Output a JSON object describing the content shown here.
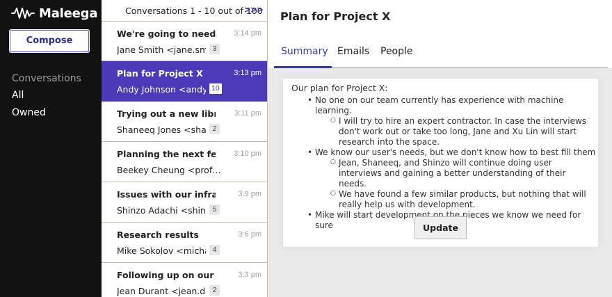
{
  "app": {
    "name": "Maleega"
  },
  "sidebar": {
    "compose_label": "Compose",
    "nav_heading": "Conversations",
    "items": [
      {
        "label": "All"
      },
      {
        "label": "Owned"
      }
    ]
  },
  "list": {
    "header": "Conversations 1 - 10 out of 100",
    "next_label": ">>>",
    "conversations": [
      {
        "subject": "We're going to need to …",
        "time": "3:14 pm",
        "from": "Jane Smith <jane.sm…",
        "count": "3"
      },
      {
        "subject": "Plan for Project X",
        "time": "3:13 pm",
        "from": "Andy Johnson <andy…",
        "count": "10"
      },
      {
        "subject": "Trying out a new librar…",
        "time": "3:11 pm",
        "from": "Shaneeq Jones <sha…",
        "count": "2"
      },
      {
        "subject": "Planning the next few …",
        "time": "3:10 pm",
        "from": "Beekey Cheung <prof…",
        "count": ""
      },
      {
        "subject": "Issues with our infrast…",
        "time": "3:9 pm",
        "from": "Shinzo Adachi <shinz…",
        "count": "5"
      },
      {
        "subject": "Research results",
        "time": "3:6 pm",
        "from": "Mike Sokolov <micha…",
        "count": "4"
      },
      {
        "subject": "Following up on our la…",
        "time": "3:3 pm",
        "from": "Jean Durant <jean.d…",
        "count": "2"
      }
    ]
  },
  "main": {
    "title": "Plan for Project X",
    "tabs": [
      {
        "label": "Summary"
      },
      {
        "label": "Emails"
      },
      {
        "label": "People"
      }
    ],
    "summary": {
      "intro": "Our plan for Project X:",
      "bullets": [
        {
          "text": "No one on our team currently has experience with machine learning.",
          "sub": [
            "I will try to hire an expert contractor. In case the interviews don't work out or take too long, Jane and Xu Lin will start research into the space."
          ]
        },
        {
          "text": "We know our user's needs, but we don't know how to best fill them",
          "sub": [
            "Jean, Shaneeq, and Shinzo will continue doing user interviews and gaining a better understanding of their needs.",
            "We have found a few similar products, but nothing that will really help us with development."
          ]
        },
        {
          "text": "Mike will start development on the pieces we know we need for sure",
          "sub": []
        }
      ],
      "update_label": "Update"
    }
  },
  "colors": {
    "accent": "#4a3ab8",
    "sidebar_bg": "#121212",
    "tab_active": "#3a3aa8"
  },
  "icons": {
    "logo": "waveform-icon"
  }
}
